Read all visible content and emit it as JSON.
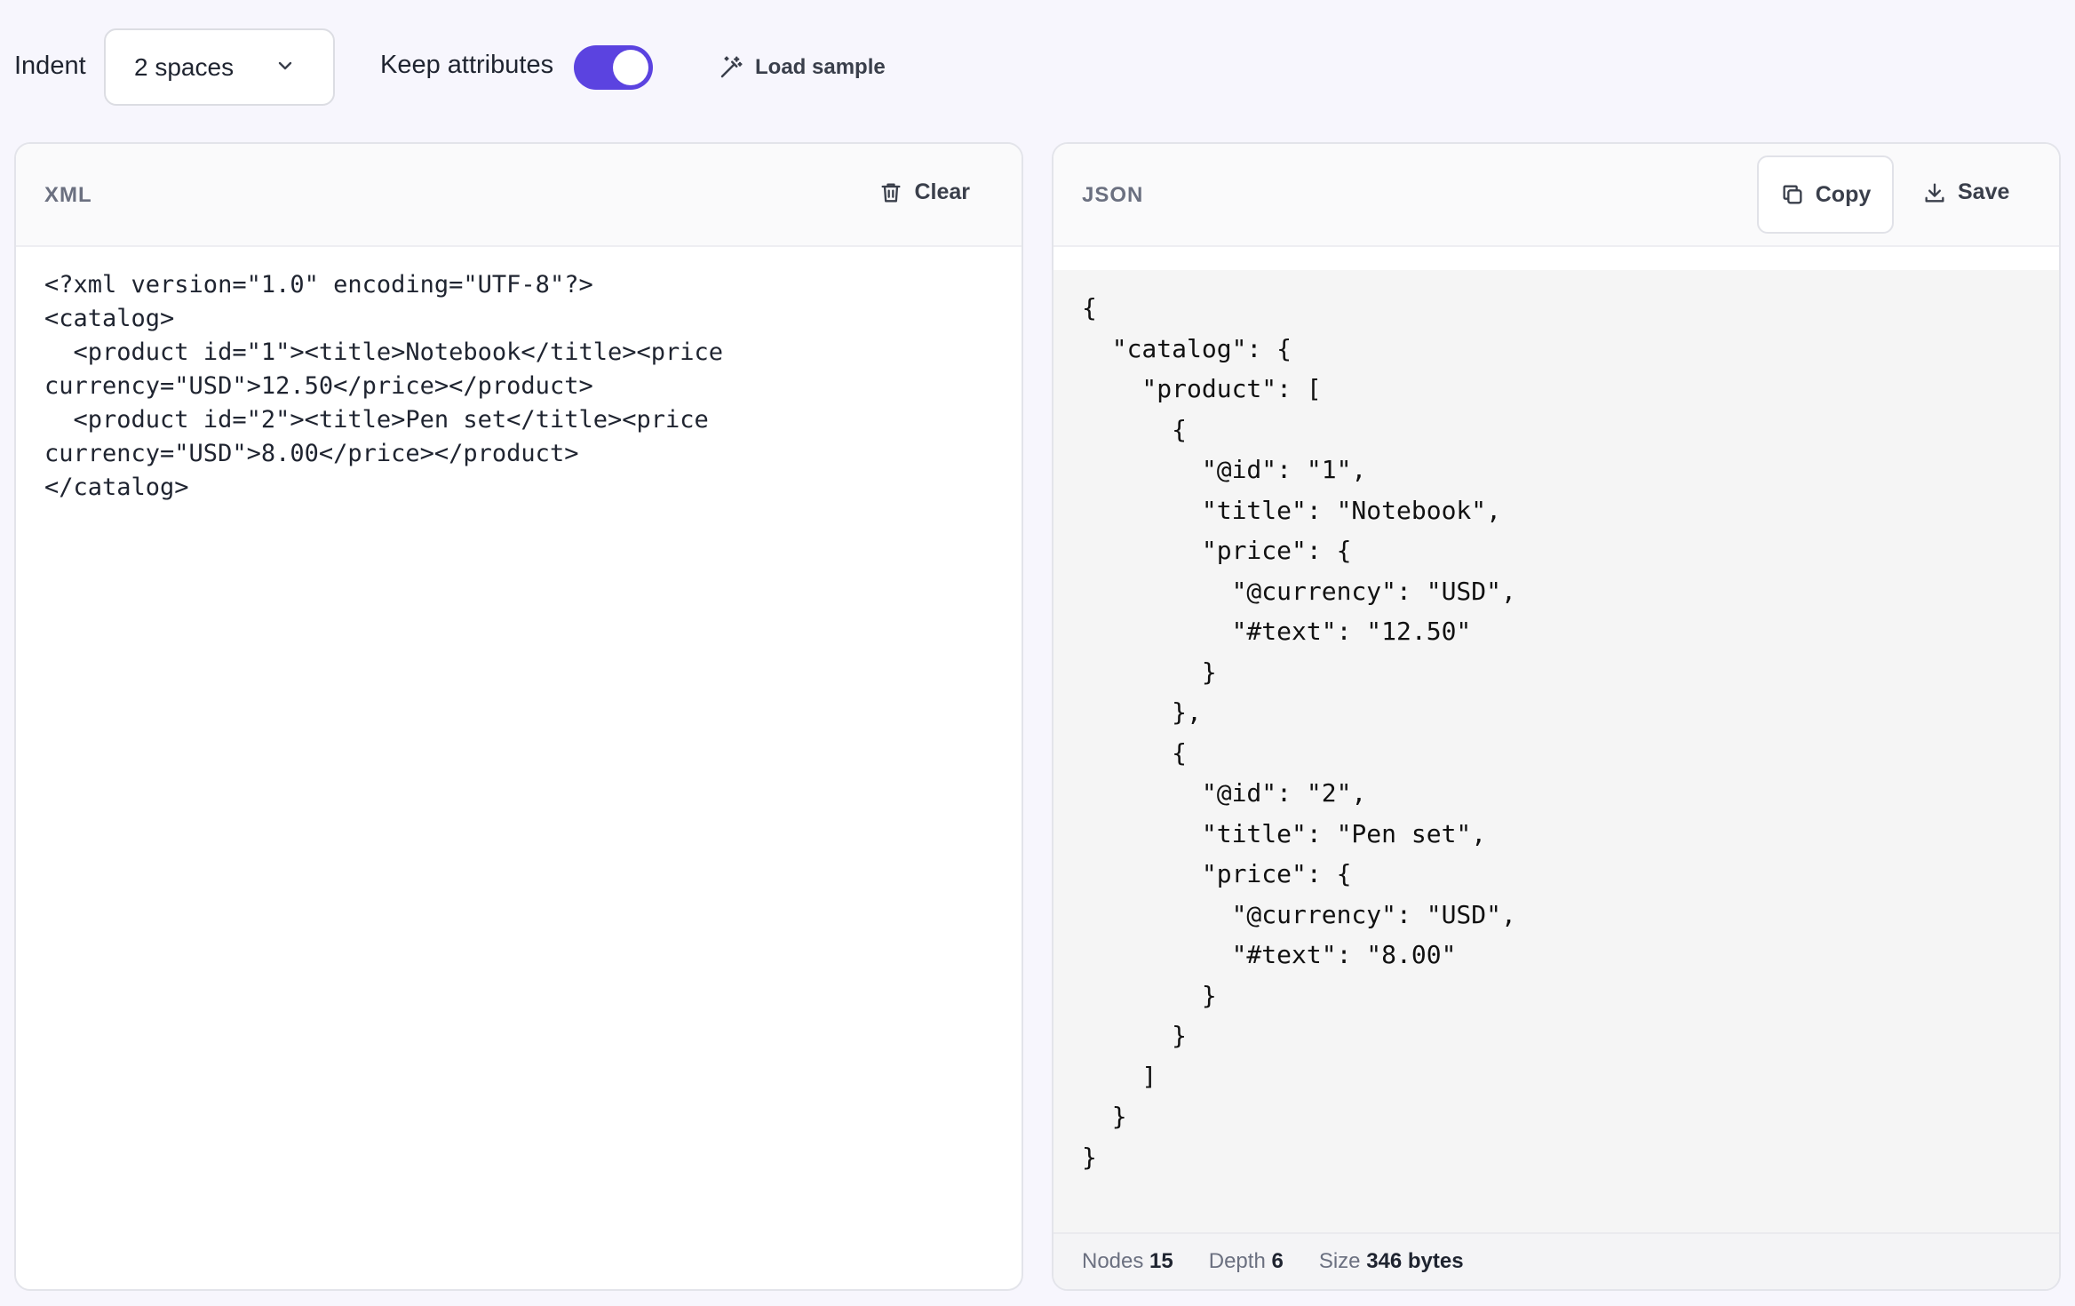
{
  "toolbar": {
    "indent_label": "Indent",
    "indent_value": "2 spaces",
    "keep_attributes_label": "Keep attributes",
    "keep_attributes_on": true,
    "load_sample_label": "Load sample"
  },
  "xml_panel": {
    "title": "XML",
    "clear_label": "Clear",
    "content": "<?xml version=\"1.0\" encoding=\"UTF-8\"?>\n<catalog>\n  <product id=\"1\"><title>Notebook</title><price\ncurrency=\"USD\">12.50</price></product>\n  <product id=\"2\"><title>Pen set</title><price\ncurrency=\"USD\">8.00</price></product>\n</catalog>"
  },
  "json_panel": {
    "title": "JSON",
    "copy_label": "Copy",
    "save_label": "Save",
    "content": "{\n  \"catalog\": {\n    \"product\": [\n      {\n        \"@id\": \"1\",\n        \"title\": \"Notebook\",\n        \"price\": {\n          \"@currency\": \"USD\",\n          \"#text\": \"12.50\"\n        }\n      },\n      {\n        \"@id\": \"2\",\n        \"title\": \"Pen set\",\n        \"price\": {\n          \"@currency\": \"USD\",\n          \"#text\": \"8.00\"\n        }\n      }\n    ]\n  }\n}",
    "stats": {
      "nodes_label": "Nodes",
      "nodes_value": "15",
      "depth_label": "Depth",
      "depth_value": "6",
      "size_label": "Size",
      "size_value": "346 bytes"
    }
  },
  "colors": {
    "accent": "#5b43e0",
    "background": "#f7f6fd"
  },
  "icons": {
    "select": "chevron-down-icon",
    "load_sample": "magic-wand-icon",
    "clear": "trash-icon",
    "copy": "copy-icon",
    "save": "download-icon"
  }
}
